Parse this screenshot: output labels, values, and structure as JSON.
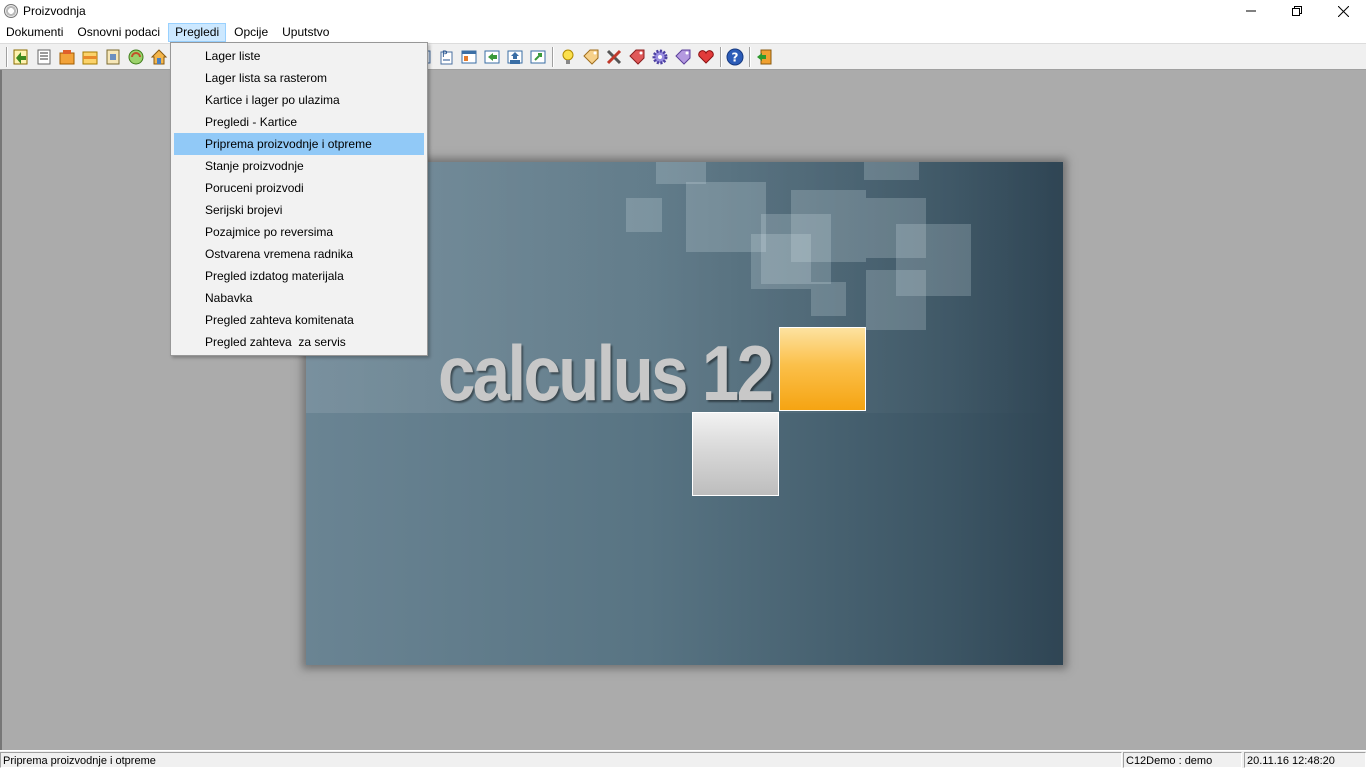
{
  "window": {
    "title": "Proizvodnja"
  },
  "menubar": {
    "items": [
      {
        "label": "Dokumenti"
      },
      {
        "label": "Osnovni podaci"
      },
      {
        "label": "Pregledi"
      },
      {
        "label": "Opcije"
      },
      {
        "label": "Uputstvo"
      }
    ],
    "active_index": 2
  },
  "dropdown": {
    "items": [
      {
        "label": "Lager liste"
      },
      {
        "label": "Lager lista sa rasterom"
      },
      {
        "label": "Kartice i lager po ulazima"
      },
      {
        "label": "Pregledi - Kartice"
      },
      {
        "label": "Priprema proizvodnje i otpreme"
      },
      {
        "label": "Stanje proizvodnje"
      },
      {
        "label": "Poruceni proizvodi"
      },
      {
        "label": "Serijski brojevi"
      },
      {
        "label": "Pozajmice po reversima"
      },
      {
        "label": "Ostvarena vremena radnika"
      },
      {
        "label": "Pregled izdatog materijala"
      },
      {
        "label": "Nabavka"
      },
      {
        "label": "Pregled zahteva komitenata"
      },
      {
        "label": "Pregled zahteva  za servis"
      }
    ],
    "highlighted_index": 4
  },
  "splash": {
    "logo_text": "calculus 12"
  },
  "statusbar": {
    "message": "Priprema proizvodnje i otpreme",
    "user": "C12Demo : demo",
    "datetime": "20.11.16 12:48:20"
  }
}
